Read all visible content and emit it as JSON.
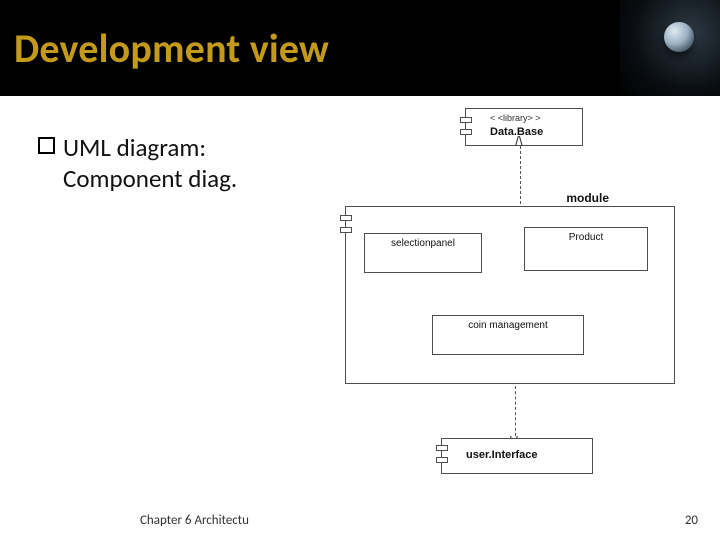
{
  "title": "Development view",
  "bullet": {
    "line1": "UML diagram:",
    "line2": "Component diag."
  },
  "diagram": {
    "database": {
      "stereotype": "< <library> >",
      "name": "Data.Base"
    },
    "module": {
      "name": "module",
      "children": {
        "selectionpanel": "selectionpanel",
        "product": "Product",
        "coin": "coin management"
      }
    },
    "userinterface": {
      "name": "user.Interface"
    },
    "arrows": {
      "up": "/\\",
      "down": "\\/"
    }
  },
  "footer": {
    "chapter": "Chapter 6 Architectu",
    "page": "20"
  }
}
